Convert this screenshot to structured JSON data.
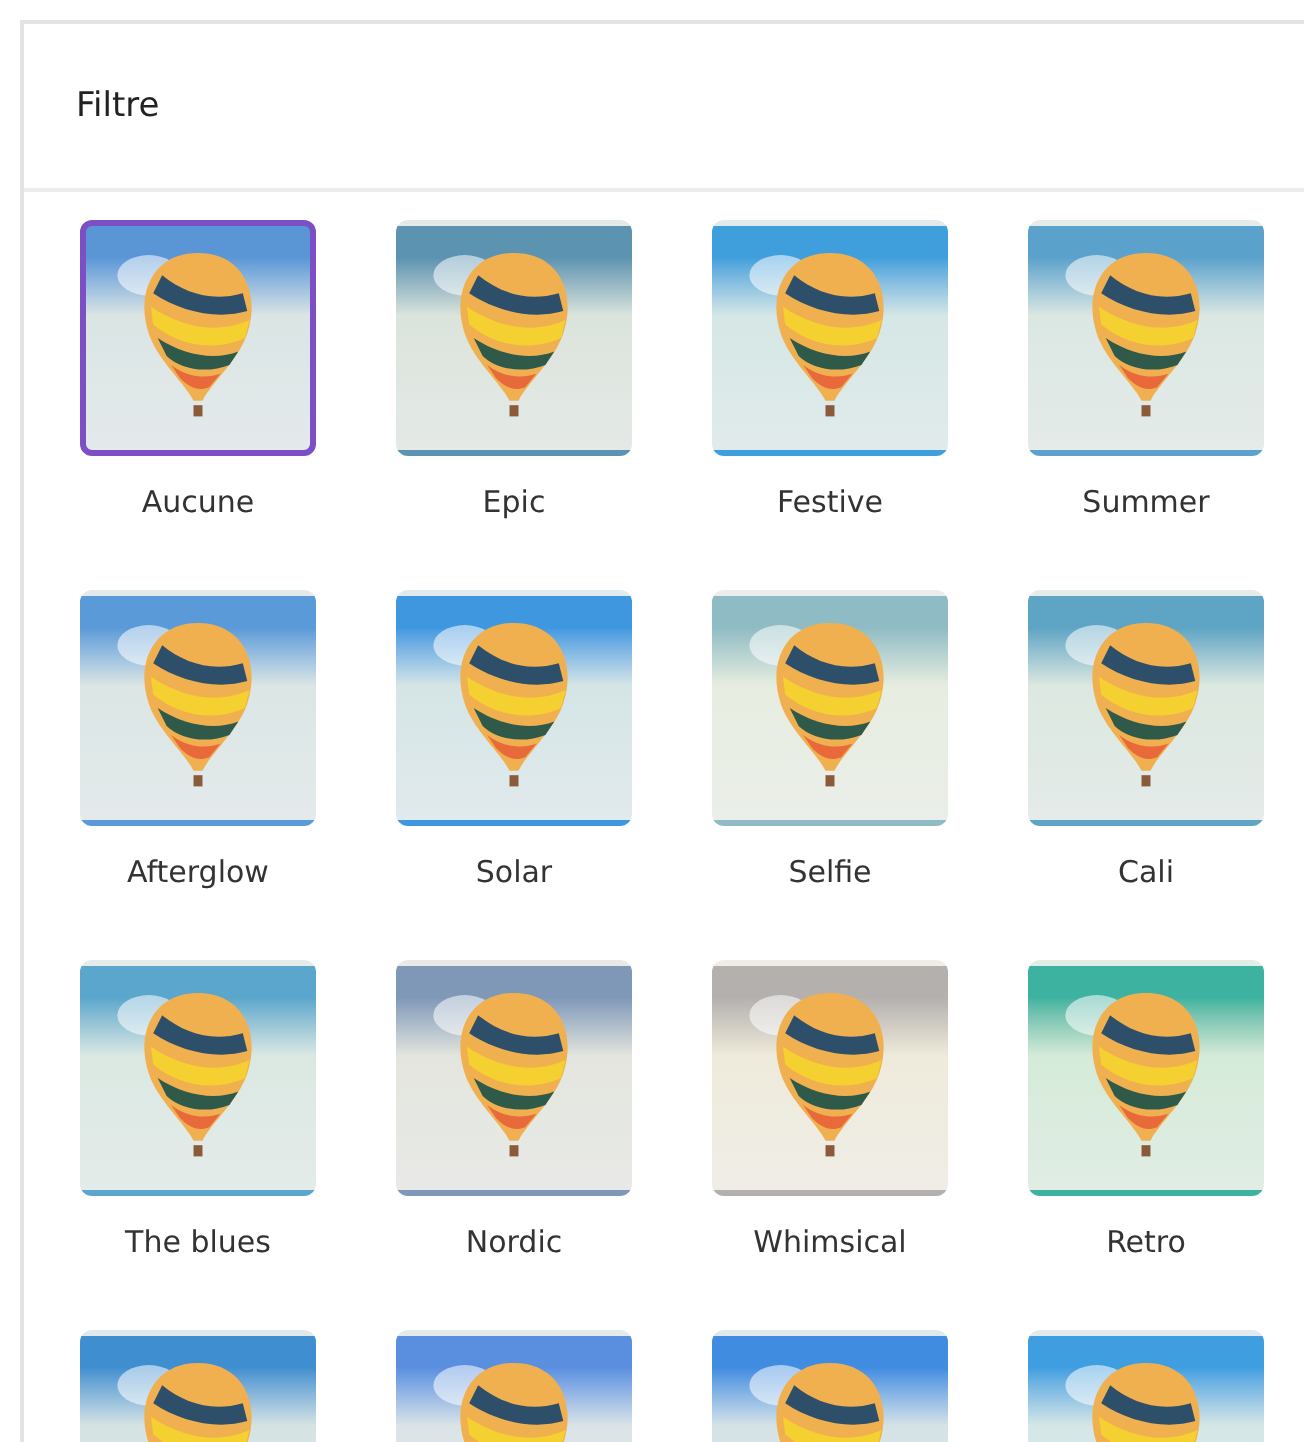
{
  "panel": {
    "title": "Filtre"
  },
  "filters": [
    {
      "label": "Aucune",
      "selected": true,
      "color": "#5a96d6"
    },
    {
      "label": "Epic",
      "selected": false,
      "color": "#5c93b0"
    },
    {
      "label": "Festive",
      "selected": false,
      "color": "#3f9fdc"
    },
    {
      "label": "Summer",
      "selected": false,
      "color": "#5aa2cc"
    },
    {
      "label": "Afterglow",
      "selected": false,
      "color": "#5a9ad8"
    },
    {
      "label": "Solar",
      "selected": false,
      "color": "#3f97e0"
    },
    {
      "label": "Selfie",
      "selected": false,
      "color": "#8fbcc4"
    },
    {
      "label": "Cali",
      "selected": false,
      "color": "#5ea4c4"
    },
    {
      "label": "The blues",
      "selected": false,
      "color": "#5aa6cc"
    },
    {
      "label": "Nordic",
      "selected": false,
      "color": "#7f98b8"
    },
    {
      "label": "Whimsical",
      "selected": false,
      "color": "#b4b0ae"
    },
    {
      "label": "Retro",
      "selected": false,
      "color": "#3eb2a0"
    },
    {
      "selected": false,
      "color": "#3f8fd0"
    },
    {
      "selected": false,
      "color": "#5a8fe0"
    },
    {
      "selected": false,
      "color": "#3f8ce0"
    },
    {
      "selected": false,
      "color": "#3f9ee0"
    }
  ]
}
